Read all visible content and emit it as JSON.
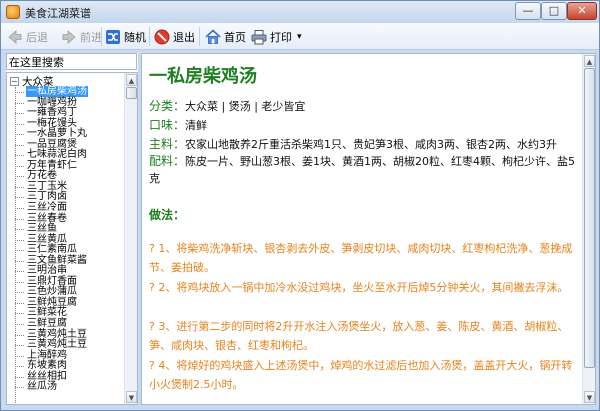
{
  "window": {
    "title": "美食江湖菜谱",
    "minimize_label": "—",
    "maximize_label": "□",
    "close_label": "✕",
    "icon": "app-icon"
  },
  "toolbar": {
    "back_label": "后退",
    "forward_label": "前进",
    "random_label": "随机",
    "exit_label": "退出",
    "home_label": "首页",
    "print_label": "打印",
    "print_dropdown": "▾"
  },
  "search": {
    "value": "在这里搜索"
  },
  "tree": {
    "root_toggle": "−",
    "root_label": "大众菜",
    "items": [
      "一私房柴鸡汤",
      "一咖喱鸡扮",
      "一雍香鸡丁",
      "一梅花馒头",
      "一水晶萝卜丸",
      "一品豆腐煲",
      "七味蒜泥白肉",
      "万年青虾仁",
      "万花卷",
      "三丁玉米",
      "三丁肉卤",
      "三丝冷面",
      "三丝春卷",
      "三丝鱼",
      "三丝黄瓜",
      "三仁素南瓜",
      "三文鱼鲜菜酱",
      "三明治串",
      "三鼎灯香面",
      "三色炒蒲瓜",
      "三鲜炖豆腐",
      "三鲜菜花",
      "三鲜豆腐",
      "三黄鸡炖土豆",
      "三黄鸡炖土豆",
      "上海醉鸡",
      "东坡素肉",
      "丝丝相扣",
      "丝瓜汤"
    ]
  },
  "recipe": {
    "title": "一私房柴鸡汤",
    "category_label": "分类：",
    "category_value": "大众菜 | 煲汤 | 老少皆宜",
    "taste_label": "口味：",
    "taste_value": "清鲜",
    "main_label": "主料：",
    "main_value": "农家山地散养2斤重活杀柴鸡1只、贵妃笋3根、咸肉3两、银杏2两、水约3升",
    "aux_label": "配料：",
    "aux_value": "陈皮一片、野山葱3根、姜1块、黄酒1两、胡椒20粒、红枣4颗、枸杞少许、盐5克",
    "method_label": "做法：",
    "steps": [
      "? 1、将柴鸡洗净斩块、银杏剥去外皮、笋剥皮切块、咸肉切块、红枣枸杞洗净、葱挽成节、姜拍破。",
      "? 2、将鸡块放入一锅中加冷水没过鸡块，坐火至水开后焯5分钟关火，其间撇去浮沫。",
      "? 3、进行第二步的同时将2升开水注入汤煲坐火，放入葱、姜、陈皮、黄酒、胡椒粒、笋、咸肉块、银杏、红枣和枸杞。",
      "? 4、将焯好的鸡块盛入上述汤煲中，焯鸡的水过滤后也加入汤煲，盖盖开大火，锅开转小火煲制2.5小时。"
    ]
  },
  "colors": {
    "title_green": "#1e7f1e",
    "step_orange": "#e8821b",
    "selection_blue": "#3399ff"
  }
}
